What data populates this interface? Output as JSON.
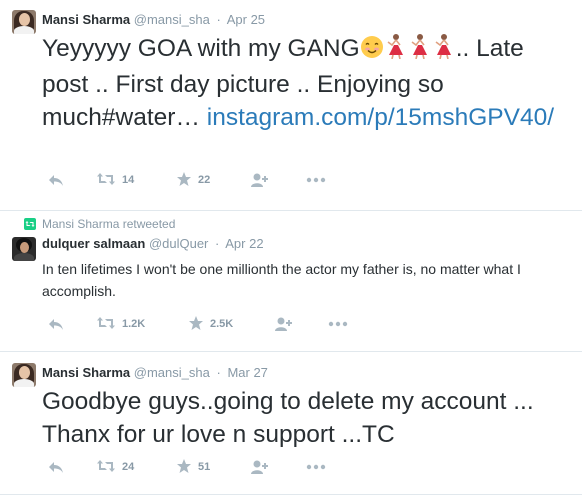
{
  "tweets": [
    {
      "name": "Mansi Sharma",
      "handle": "@mansi_sha",
      "time": "Apr 25",
      "text": "Yeyyyyy GOA with my GANG",
      "text_after_emoji": ".. Late post .. First day picture .. Enjoying so much#water… ",
      "link_text": "instagram.com/p/15mshGPV40/",
      "retweets": "14",
      "favorites": "22"
    },
    {
      "retweeted_by": "Mansi Sharma retweeted",
      "name": "dulquer salmaan",
      "handle": "@dulQuer",
      "time": "Apr 22",
      "text": "In ten lifetimes I won't be one millionth the actor my father is, no matter what I accomplish.",
      "retweets": "1.2K",
      "favorites": "2.5K"
    },
    {
      "name": "Mansi Sharma",
      "handle": "@mansi_sha",
      "time": "Mar 27",
      "text": "Goodbye guys..going to delete my account ... Thanx for ur love n support ...TC",
      "retweets": "24",
      "favorites": "51"
    }
  ],
  "icons": {
    "reply": "reply-icon",
    "retweet": "retweet-icon",
    "favorite": "star-icon",
    "follow": "follow-icon",
    "more": "more-icon",
    "emoji_smile": "smiling-face-emoji",
    "emoji_dancer": "dancer-emoji"
  },
  "colors": {
    "link": "#2b7bb9",
    "muted": "#8899a6",
    "text": "#292f33",
    "retweet_green": "#19cf86"
  }
}
